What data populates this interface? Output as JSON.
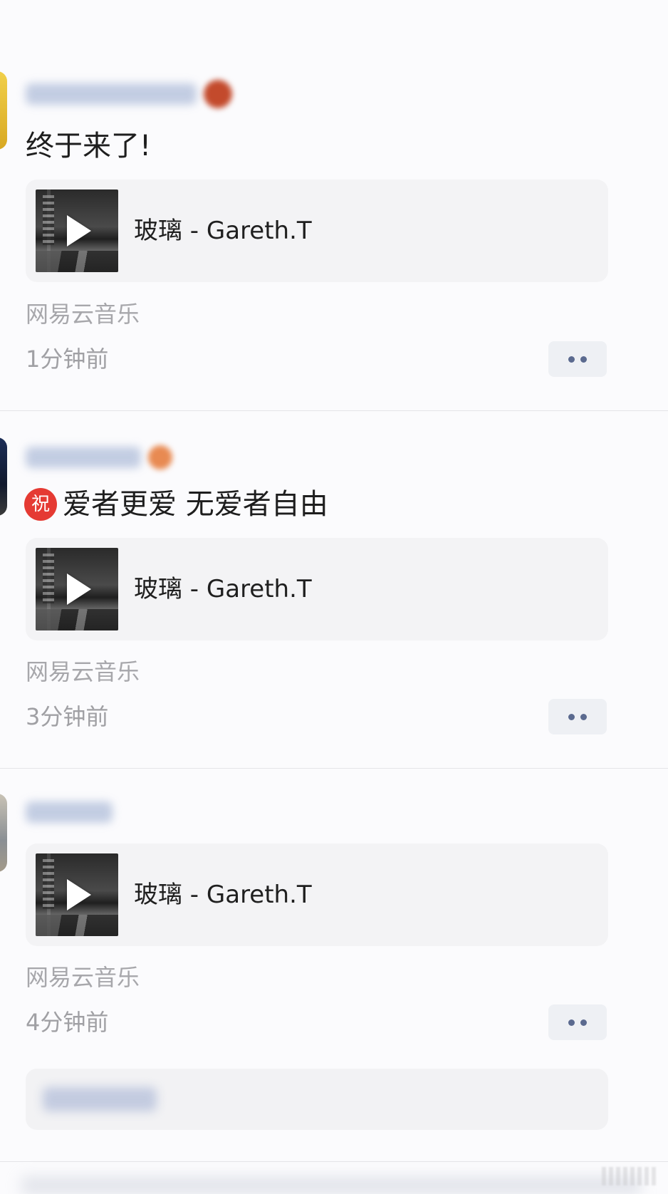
{
  "posts": [
    {
      "text": "终于来了!",
      "badge": "",
      "music": {
        "title": "玻璃 - Gareth.T",
        "play_icon": "play-icon"
      },
      "source": "网易云音乐",
      "time": "1分钟前",
      "more_icon": "more-dots-icon"
    },
    {
      "text": "爱者更爱 无爱者自由",
      "badge": "祝",
      "music": {
        "title": "玻璃 - Gareth.T",
        "play_icon": "play-icon"
      },
      "source": "网易云音乐",
      "time": "3分钟前",
      "more_icon": "more-dots-icon"
    },
    {
      "text": "",
      "badge": "",
      "music": {
        "title": "玻璃 - Gareth.T",
        "play_icon": "play-icon"
      },
      "source": "网易云音乐",
      "time": "4分钟前",
      "more_icon": "more-dots-icon"
    }
  ],
  "colors": {
    "background": "#fbfbfd",
    "card": "#f3f3f5",
    "meta_text": "#a7a7ab",
    "more_dots": "#5b6a8f",
    "badge_red": "#e53a33"
  }
}
